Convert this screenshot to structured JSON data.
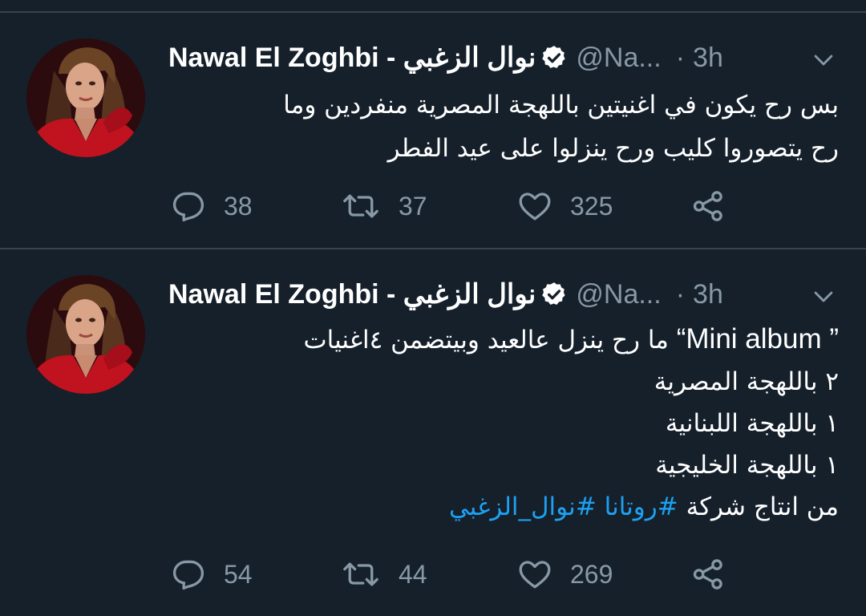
{
  "colors": {
    "background": "#15202b",
    "divider": "#38444d",
    "text_primary": "#ffffff",
    "text_secondary": "#8899a6",
    "link": "#1da1f2"
  },
  "icons": [
    "verified-icon",
    "chevron-down-icon",
    "reply-icon",
    "retweet-icon",
    "like-icon",
    "share-icon"
  ],
  "tweets": [
    {
      "author": {
        "name": "Nawal El Zoghbi - نوال الزغبي",
        "handle": "@Na...",
        "separator": "·",
        "time": "3h"
      },
      "lines": [
        "بس رح يكون في اغنيتين باللهجة المصرية منفردين وما",
        "رح يتصوروا كليب ورح ينزلوا على عيد الفطر"
      ],
      "stats": {
        "replies": "38",
        "retweets": "37",
        "likes": "325"
      }
    },
    {
      "author": {
        "name": "Nawal El Zoghbi - نوال الزغبي",
        "handle": "@Na...",
        "separator": "·",
        "time": "3h"
      },
      "first_line": {
        "quote": "“Mini album ”",
        "rest": " ما رح ينزل عالعيد وبيتضمن ٤اغنيات"
      },
      "lines": [
        "٢ باللهجة المصرية",
        "١ باللهجة اللبنانية",
        "١ باللهجة الخليجية"
      ],
      "last_line": {
        "text": "من انتاج شركة ",
        "hashtag1": "#روتانا",
        "space": " ",
        "hashtag2": "#نوال_الزغبي"
      },
      "stats": {
        "replies": "54",
        "retweets": "44",
        "likes": "269"
      }
    }
  ]
}
